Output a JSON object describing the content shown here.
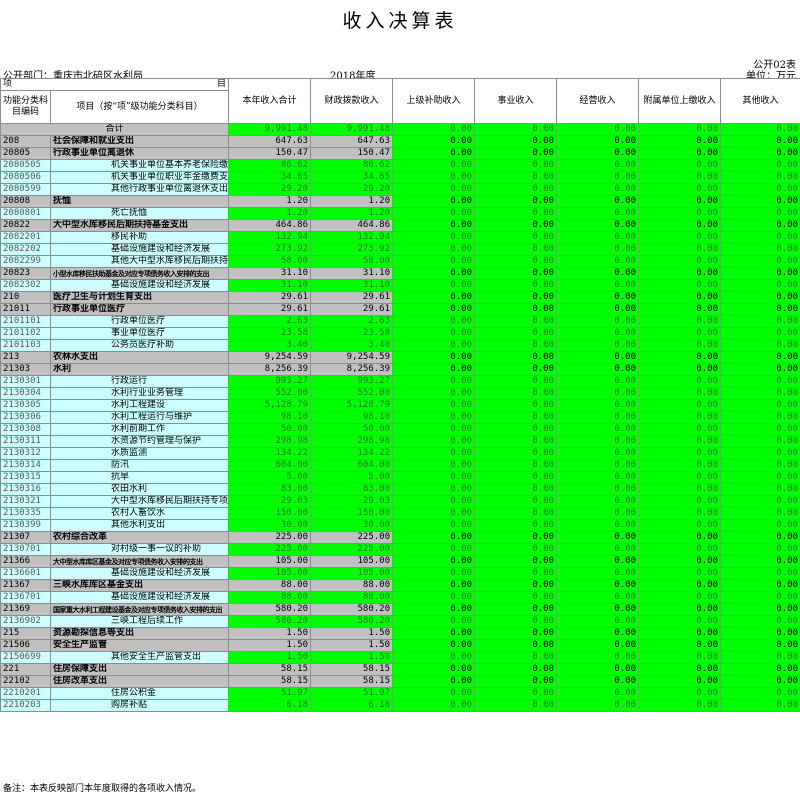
{
  "title": "收入决算表",
  "form_no": "公开02表",
  "dept_label": "公开部门：重庆市北碚区水利局",
  "year": "2018年度",
  "unit": "单位：万元",
  "headers": {
    "proj_left": "项",
    "proj_right": "目",
    "code": "功能分类科目编码",
    "name": "项目（按“项”级功能分类科目）",
    "cols": [
      "本年收入合计",
      "财政拨款收入",
      "上级补助收入",
      "事业收入",
      "经营收入",
      "附属单位上缴收入",
      "其他收入"
    ]
  },
  "total_label": "合计",
  "rows": [
    {
      "lv": 0,
      "code": "",
      "name": "合计",
      "v": [
        "9,991.48",
        "9,991.48",
        "0.00",
        "0.00",
        "0.00",
        "0.00",
        "0.00"
      ]
    },
    {
      "lv": 1,
      "code": "208",
      "name": "社会保障和就业支出",
      "v": [
        "647.63",
        "647.63",
        "0.00",
        "0.00",
        "0.00",
        "0.00",
        "0.00"
      ]
    },
    {
      "lv": 2,
      "code": "20805",
      "name": "行政事业单位离退休",
      "v": [
        "150.47",
        "150.47",
        "0.00",
        "0.00",
        "0.00",
        "0.00",
        "0.00"
      ]
    },
    {
      "lv": 3,
      "code": "2080505",
      "name": "机关事业单位基本养老保险缴费支出",
      "v": [
        "86.62",
        "86.62",
        "0.00",
        "0.00",
        "0.00",
        "0.00",
        "0.00"
      ]
    },
    {
      "lv": 3,
      "code": "2080506",
      "name": "机关事业单位职业年金缴费支出",
      "v": [
        "34.65",
        "34.65",
        "0.00",
        "0.00",
        "0.00",
        "0.00",
        "0.00"
      ]
    },
    {
      "lv": 3,
      "code": "2080599",
      "name": "其他行政事业单位离退休支出",
      "v": [
        "29.20",
        "29.20",
        "0.00",
        "0.00",
        "0.00",
        "0.00",
        "0.00"
      ]
    },
    {
      "lv": 2,
      "code": "20808",
      "name": "抚恤",
      "v": [
        "1.20",
        "1.20",
        "0.00",
        "0.00",
        "0.00",
        "0.00",
        "0.00"
      ]
    },
    {
      "lv": 3,
      "code": "2080801",
      "name": "死亡抚恤",
      "v": [
        "1.20",
        "1.20",
        "0.00",
        "0.00",
        "0.00",
        "0.00",
        "0.00"
      ]
    },
    {
      "lv": 2,
      "code": "20822",
      "name": "大中型水库移民后期扶持基金支出",
      "v": [
        "464.86",
        "464.86",
        "0.00",
        "0.00",
        "0.00",
        "0.00",
        "0.00"
      ]
    },
    {
      "lv": 3,
      "code": "2082201",
      "name": "移民补助",
      "v": [
        "132.94",
        "132.94",
        "0.00",
        "0.00",
        "0.00",
        "0.00",
        "0.00"
      ]
    },
    {
      "lv": 3,
      "code": "2082202",
      "name": "基础设施建设和经济发展",
      "v": [
        "273.92",
        "273.92",
        "0.00",
        "0.00",
        "0.00",
        "0.00",
        "0.00"
      ]
    },
    {
      "lv": 3,
      "code": "2082299",
      "name": "其他大中型水库移民后期扶持基金支出",
      "v": [
        "58.00",
        "58.00",
        "0.00",
        "0.00",
        "0.00",
        "0.00",
        "0.00"
      ]
    },
    {
      "lv": 2,
      "code": "20823",
      "name": "小型水库移民扶助基金及对应专项债务收入安排的支出",
      "tiny": true,
      "v": [
        "31.10",
        "31.10",
        "0.00",
        "0.00",
        "0.00",
        "0.00",
        "0.00"
      ]
    },
    {
      "lv": 3,
      "code": "2082302",
      "name": "基础设施建设和经济发展",
      "v": [
        "31.10",
        "31.10",
        "0.00",
        "0.00",
        "0.00",
        "0.00",
        "0.00"
      ]
    },
    {
      "lv": 1,
      "code": "210",
      "name": "医疗卫生与计划生育支出",
      "v": [
        "29.61",
        "29.61",
        "0.00",
        "0.00",
        "0.00",
        "0.00",
        "0.00"
      ]
    },
    {
      "lv": 2,
      "code": "21011",
      "name": "行政事业单位医疗",
      "v": [
        "29.61",
        "29.61",
        "0.00",
        "0.00",
        "0.00",
        "0.00",
        "0.00"
      ]
    },
    {
      "lv": 3,
      "code": "2101101",
      "name": "行政单位医疗",
      "v": [
        "2.63",
        "2.63",
        "0.00",
        "0.00",
        "0.00",
        "0.00",
        "0.00"
      ]
    },
    {
      "lv": 3,
      "code": "2101102",
      "name": "事业单位医疗",
      "v": [
        "23.58",
        "23.58",
        "0.00",
        "0.00",
        "0.00",
        "0.00",
        "0.00"
      ]
    },
    {
      "lv": 3,
      "code": "2101103",
      "name": "公务员医疗补助",
      "v": [
        "3.40",
        "3.40",
        "0.00",
        "0.00",
        "0.00",
        "0.00",
        "0.00"
      ]
    },
    {
      "lv": 1,
      "code": "213",
      "name": "农林水支出",
      "v": [
        "9,254.59",
        "9,254.59",
        "0.00",
        "0.00",
        "0.00",
        "0.00",
        "0.00"
      ]
    },
    {
      "lv": 2,
      "code": "21303",
      "name": "水利",
      "v": [
        "8,256.39",
        "8,256.39",
        "0.00",
        "0.00",
        "0.00",
        "0.00",
        "0.00"
      ]
    },
    {
      "lv": 3,
      "code": "2130301",
      "name": "行政运行",
      "v": [
        "993.27",
        "993.27",
        "0.00",
        "0.00",
        "0.00",
        "0.00",
        "0.00"
      ]
    },
    {
      "lv": 3,
      "code": "2130304",
      "name": "水利行业业务管理",
      "v": [
        "552.00",
        "552.00",
        "0.00",
        "0.00",
        "0.00",
        "0.00",
        "0.00"
      ]
    },
    {
      "lv": 3,
      "code": "2130305",
      "name": "水利工程建设",
      "v": [
        "5,128.79",
        "5,128.79",
        "0.00",
        "0.00",
        "0.00",
        "0.00",
        "0.00"
      ]
    },
    {
      "lv": 3,
      "code": "2130306",
      "name": "水利工程运行与维护",
      "v": [
        "98.10",
        "98.10",
        "0.00",
        "0.00",
        "0.00",
        "0.00",
        "0.00"
      ]
    },
    {
      "lv": 3,
      "code": "2130308",
      "name": "水利前期工作",
      "v": [
        "50.00",
        "50.00",
        "0.00",
        "0.00",
        "0.00",
        "0.00",
        "0.00"
      ]
    },
    {
      "lv": 3,
      "code": "2130311",
      "name": "水资源节约管理与保护",
      "v": [
        "298.98",
        "298.98",
        "0.00",
        "0.00",
        "0.00",
        "0.00",
        "0.00"
      ]
    },
    {
      "lv": 3,
      "code": "2130312",
      "name": "水质监测",
      "v": [
        "134.22",
        "134.22",
        "0.00",
        "0.00",
        "0.00",
        "0.00",
        "0.00"
      ]
    },
    {
      "lv": 3,
      "code": "2130314",
      "name": "防汛",
      "v": [
        "604.00",
        "604.00",
        "0.00",
        "0.00",
        "0.00",
        "0.00",
        "0.00"
      ]
    },
    {
      "lv": 3,
      "code": "2130315",
      "name": "抗旱",
      "v": [
        "5.00",
        "5.00",
        "0.00",
        "0.00",
        "0.00",
        "0.00",
        "0.00"
      ]
    },
    {
      "lv": 3,
      "code": "2130316",
      "name": "农田水利",
      "v": [
        "83.00",
        "83.00",
        "0.00",
        "0.00",
        "0.00",
        "0.00",
        "0.00"
      ]
    },
    {
      "lv": 3,
      "code": "2130321",
      "name": "大中型水库移民后期扶持专项支出",
      "v": [
        "29.03",
        "29.03",
        "0.00",
        "0.00",
        "0.00",
        "0.00",
        "0.00"
      ]
    },
    {
      "lv": 3,
      "code": "2130335",
      "name": "农村人畜饮水",
      "v": [
        "150.00",
        "150.00",
        "0.00",
        "0.00",
        "0.00",
        "0.00",
        "0.00"
      ]
    },
    {
      "lv": 3,
      "code": "2130399",
      "name": "其他水利支出",
      "v": [
        "30.00",
        "30.00",
        "0.00",
        "0.00",
        "0.00",
        "0.00",
        "0.00"
      ]
    },
    {
      "lv": 2,
      "code": "21307",
      "name": "农村综合改革",
      "v": [
        "225.00",
        "225.00",
        "0.00",
        "0.00",
        "0.00",
        "0.00",
        "0.00"
      ]
    },
    {
      "lv": 3,
      "code": "2130701",
      "name": "对村级一事一议的补助",
      "v": [
        "225.00",
        "225.00",
        "0.00",
        "0.00",
        "0.00",
        "0.00",
        "0.00"
      ]
    },
    {
      "lv": 2,
      "code": "21366",
      "name": "大中型水库库区基金及对应专项债务收入安排的支出",
      "tiny": true,
      "v": [
        "105.00",
        "105.00",
        "0.00",
        "0.00",
        "0.00",
        "0.00",
        "0.00"
      ]
    },
    {
      "lv": 3,
      "code": "2136601",
      "name": "基础设施建设和经济发展",
      "v": [
        "105.00",
        "105.00",
        "0.00",
        "0.00",
        "0.00",
        "0.00",
        "0.00"
      ]
    },
    {
      "lv": 2,
      "code": "21367",
      "name": "三峡水库库区基金支出",
      "v": [
        "88.00",
        "88.00",
        "0.00",
        "0.00",
        "0.00",
        "0.00",
        "0.00"
      ]
    },
    {
      "lv": 3,
      "code": "2136701",
      "name": "基础设施建设和经济发展",
      "v": [
        "88.00",
        "88.00",
        "0.00",
        "0.00",
        "0.00",
        "0.00",
        "0.00"
      ]
    },
    {
      "lv": 2,
      "code": "21369",
      "name": "国家重大水利工程建设基金及对应专项债务收入安排的支出",
      "tiny": true,
      "v": [
        "580.20",
        "580.20",
        "0.00",
        "0.00",
        "0.00",
        "0.00",
        "0.00"
      ]
    },
    {
      "lv": 3,
      "code": "2136902",
      "name": "三峡工程后续工作",
      "v": [
        "580.20",
        "580.20",
        "0.00",
        "0.00",
        "0.00",
        "0.00",
        "0.00"
      ]
    },
    {
      "lv": 1,
      "code": "215",
      "name": "资源勘探信息等支出",
      "v": [
        "1.50",
        "1.50",
        "0.00",
        "0.00",
        "0.00",
        "0.00",
        "0.00"
      ]
    },
    {
      "lv": 2,
      "code": "21506",
      "name": "安全生产监管",
      "v": [
        "1.50",
        "1.50",
        "0.00",
        "0.00",
        "0.00",
        "0.00",
        "0.00"
      ]
    },
    {
      "lv": 3,
      "code": "2150699",
      "name": "其他安全生产监管支出",
      "v": [
        "1.50",
        "1.50",
        "0.00",
        "0.00",
        "0.00",
        "0.00",
        "0.00"
      ]
    },
    {
      "lv": 1,
      "code": "221",
      "name": "住房保障支出",
      "v": [
        "58.15",
        "58.15",
        "0.00",
        "0.00",
        "0.00",
        "0.00",
        "0.00"
      ]
    },
    {
      "lv": 2,
      "code": "22102",
      "name": "住房改革支出",
      "v": [
        "58.15",
        "58.15",
        "0.00",
        "0.00",
        "0.00",
        "0.00",
        "0.00"
      ]
    },
    {
      "lv": 3,
      "code": "2210201",
      "name": "住房公积金",
      "v": [
        "51.97",
        "51.97",
        "0.00",
        "0.00",
        "0.00",
        "0.00",
        "0.00"
      ]
    },
    {
      "lv": 3,
      "code": "2210203",
      "name": "购房补贴",
      "v": [
        "6.18",
        "6.18",
        "0.00",
        "0.00",
        "0.00",
        "0.00",
        "0.00"
      ]
    }
  ],
  "note": "备注：本表反映部门本年度取得的各项收入情况。"
}
